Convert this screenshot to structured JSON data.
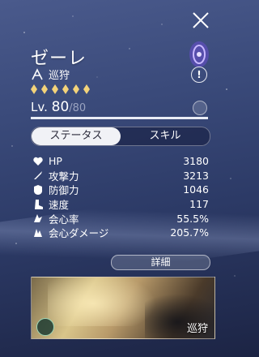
{
  "character": {
    "name": "ゼーレ",
    "path": "巡狩",
    "rarity_stars": 6,
    "level_prefix": "Lv.",
    "level_current": "80",
    "level_max": "/80",
    "level_progress": 1.0
  },
  "tabs": [
    {
      "label": "ステータス",
      "active": true
    },
    {
      "label": "スキル",
      "active": false
    }
  ],
  "stats": [
    {
      "label": "HP",
      "value": "3180",
      "icon": "heart-icon"
    },
    {
      "label": "攻撃力",
      "value": "3213",
      "icon": "sword-icon"
    },
    {
      "label": "防御力",
      "value": "1046",
      "icon": "shield-icon"
    },
    {
      "label": "速度",
      "value": "117",
      "icon": "boot-icon"
    },
    {
      "label": "会心率",
      "value": "55.5%",
      "icon": "crit-rate-icon"
    },
    {
      "label": "会心ダメージ",
      "value": "205.7%",
      "icon": "crit-damage-icon"
    }
  ],
  "details_label": "詳細",
  "info_label": "!",
  "lightcone": {
    "path_label": "巡狩"
  },
  "colors": {
    "accent": "#f3d37a",
    "emblem": "#7a5cd6",
    "tab_active": "#f1f2f6"
  }
}
